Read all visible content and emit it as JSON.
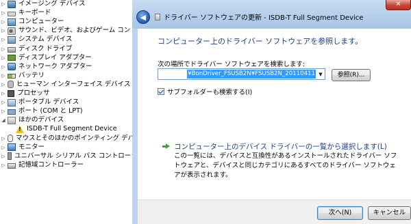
{
  "tree": {
    "items": [
      {
        "label": "イメージング デバイス",
        "icon": "camera-icon",
        "expander": "▷",
        "indent": 0
      },
      {
        "label": "キーボード",
        "icon": "keyboard-icon",
        "expander": "▷",
        "indent": 0
      },
      {
        "label": "コンピューター",
        "icon": "computer-icon",
        "expander": "▷",
        "indent": 0
      },
      {
        "label": "サウンド、ビデオ、およびゲーム コントローラー",
        "icon": "speaker-icon",
        "expander": "▷",
        "indent": 0
      },
      {
        "label": "システム デバイス",
        "icon": "system-device-icon",
        "expander": "▷",
        "indent": 0
      },
      {
        "label": "ディスク ドライブ",
        "icon": "disk-drive-icon",
        "expander": "▷",
        "indent": 0
      },
      {
        "label": "ディスプレイ アダプター",
        "icon": "display-adapter-icon",
        "expander": "▷",
        "indent": 0
      },
      {
        "label": "ネットワーク アダプター",
        "icon": "network-adapter-icon",
        "expander": "▷",
        "indent": 0
      },
      {
        "label": "バッテリ",
        "icon": "battery-icon",
        "expander": "▷",
        "indent": 0
      },
      {
        "label": "ヒューマン インターフェイス デバイス",
        "icon": "hid-icon",
        "expander": "▷",
        "indent": 0
      },
      {
        "label": "プロセッサ",
        "icon": "processor-icon",
        "expander": "▷",
        "indent": 0
      },
      {
        "label": "ポータブル デバイス",
        "icon": "portable-device-icon",
        "expander": "▷",
        "indent": 0
      },
      {
        "label": "ポート (COM と LPT)",
        "icon": "port-icon",
        "expander": "▷",
        "indent": 0
      },
      {
        "label": "ほかのデバイス",
        "icon": "other-devices-icon",
        "expander": "◢",
        "indent": 0
      },
      {
        "label": "ISDB-T Full Segment Device",
        "icon": "warning-icon",
        "expander": "",
        "indent": 1
      },
      {
        "label": "マウスとそのほかのポインティング デバイス",
        "icon": "mouse-icon",
        "expander": "▷",
        "indent": 0
      },
      {
        "label": "モニター",
        "icon": "monitor-icon",
        "expander": "▷",
        "indent": 0
      },
      {
        "label": "ユニバーサル シリアル バス コントローラー",
        "icon": "usb-icon",
        "expander": "▷",
        "indent": 0
      },
      {
        "label": "記憶域コントローラー",
        "icon": "storage-controller-icon",
        "expander": "▷",
        "indent": 0
      }
    ]
  },
  "dialog": {
    "title": "ドライバー ソフトウェアの更新 - ISDB-T Full Segment Device",
    "back_icon": "back-arrow-icon",
    "close_label": "✕",
    "heading": "コンピューター上のドライバー ソフトウェアを参照します。",
    "search_label": "次の場所でドライバー ソフトウェアを検索します:",
    "path_value": "¥BonDriver_FSUSB2N¥FSUSB2N_20110411",
    "browse_label": "参照(R)...",
    "subfolder_label": "サブフォルダーも検索する(I)",
    "subfolder_checked": true,
    "pick_link": "コンピューター上のデバイス ドライバーの一覧から選択します(L)",
    "pick_desc": "この一覧には、デバイスと互換性があるインストールされたドライバー ソフトウェアと、デバイスと同じカテゴリにあるすべてのドライバー ソフトウェアが表示されます。",
    "next_label": "次へ(N)",
    "cancel_label": "キャンセル"
  },
  "colors": {
    "link": "#1e3f8a",
    "selection": "#3399ff",
    "close": "#c9453a",
    "arrow": "#3fa535"
  }
}
